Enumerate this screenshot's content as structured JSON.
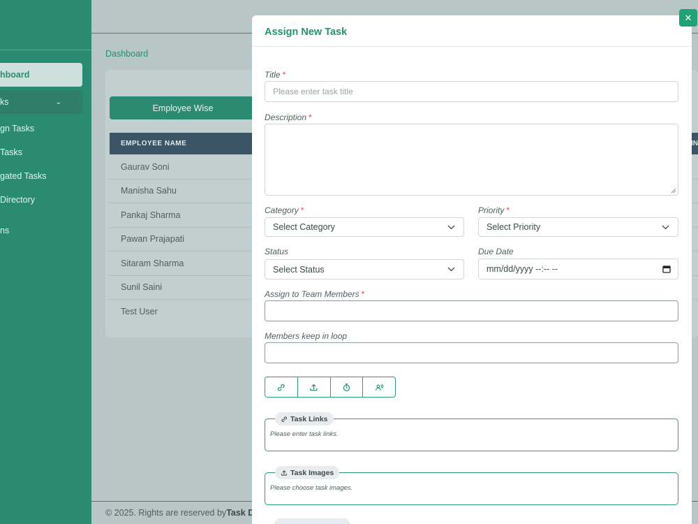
{
  "sidebar": {
    "items": [
      {
        "label": "hboard"
      },
      {
        "label": "ks"
      },
      {
        "label": "gn Tasks"
      },
      {
        "label": "Tasks"
      },
      {
        "label": "gated Tasks"
      },
      {
        "label": " Directory"
      },
      {
        "label": "ns"
      }
    ]
  },
  "breadcrumb": "Dashboard",
  "report": {
    "tab_label": "Employee Wise",
    "column_header": "EMPLOYEE NAME",
    "column_header_right": "IN",
    "employees": [
      "Gaurav Soni",
      "Manisha Sahu",
      "Pankaj Sharma",
      "Pawan Prajapati",
      "Sitaram Sharma",
      "Sunil Saini",
      "Test User"
    ]
  },
  "footer": {
    "text": "© 2025. Rights are reserved by ",
    "brand": "Task D"
  },
  "modal": {
    "title": "Assign New Task",
    "close_glyph": "✕",
    "required_mark": "*",
    "title_field": {
      "label": "Title",
      "placeholder": "Please enter task title"
    },
    "description": {
      "label": "Description"
    },
    "category": {
      "label": "Category",
      "value": "Select Category"
    },
    "priority": {
      "label": "Priority",
      "value": "Select Priority"
    },
    "status": {
      "label": "Status",
      "value": "Select Status"
    },
    "due_date": {
      "label": "Due Date",
      "value": "mm/dd/yyyy --:-- --"
    },
    "assign": {
      "label": "Assign to Team Members"
    },
    "loop": {
      "label": "Members keep in loop"
    },
    "attachments": [
      {
        "label": "Task Links",
        "placeholder": "Please enter task links."
      },
      {
        "label": "Task Images",
        "placeholder": "Please choose task images."
      }
    ]
  },
  "colors": {
    "accent": "#2a8a72",
    "modal_accent": "#23936f",
    "required": "#e04848"
  }
}
